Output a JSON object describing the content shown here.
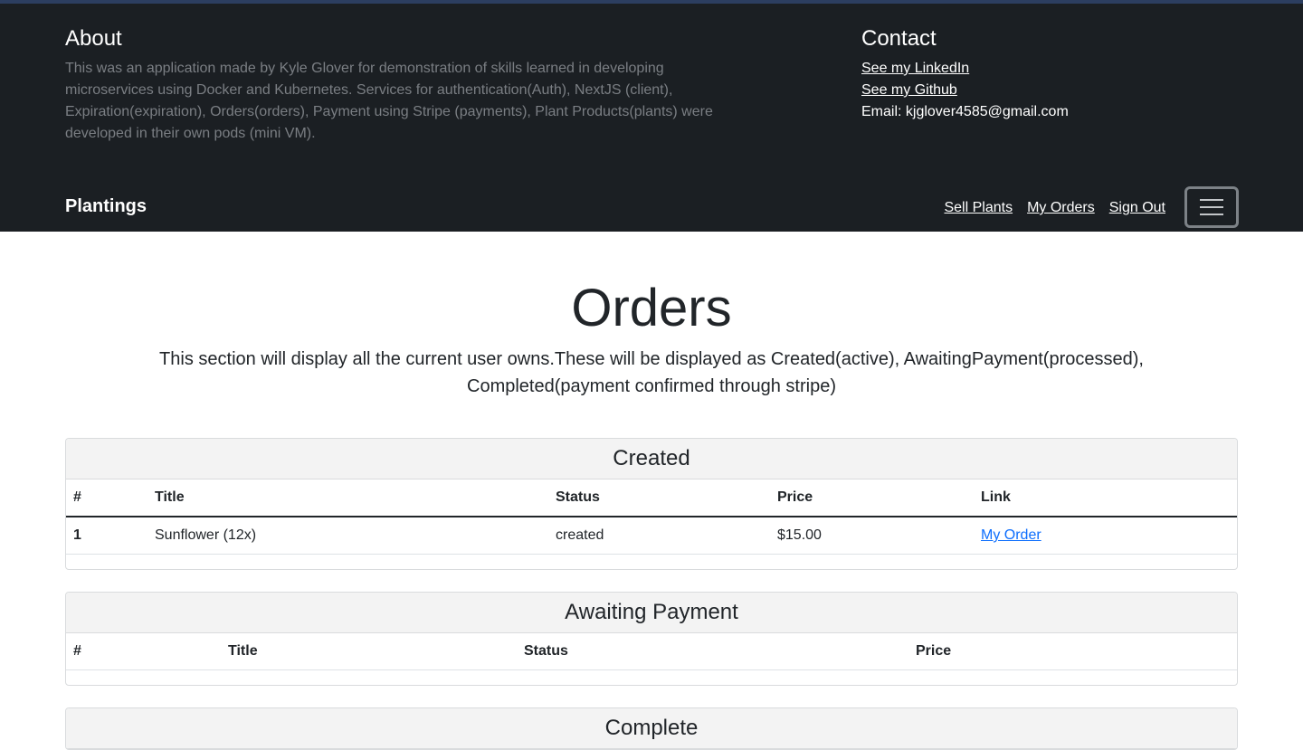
{
  "about": {
    "heading": "About",
    "text": "This was an application made by Kyle Glover for demonstration of skills learned in developing microservices using Docker and Kubernetes. Services for authentication(Auth), NextJS (client), Expiration(expiration), Orders(orders), Payment using Stripe (payments), Plant Products(plants) were developed in their own pods (mini VM)."
  },
  "contact": {
    "heading": "Contact",
    "linkedin": "See my LinkedIn",
    "github": "See my Github",
    "email": "Email: kjglover4585@gmail.com"
  },
  "navbar": {
    "brand": "Plantings",
    "links": [
      "Sell Plants",
      "My Orders",
      "Sign Out"
    ],
    "toggler_icon": "hamburger-icon"
  },
  "page": {
    "title": "Orders",
    "description": "This section will display all the current user owns.These will be displayed as Created(active), AwaitingPayment(processed), Completed(payment confirmed through stripe)"
  },
  "created": {
    "heading": "Created",
    "columns": [
      "#",
      "Title",
      "Status",
      "Price",
      "Link"
    ],
    "rows": [
      {
        "index": "1",
        "title": "Sunflower (12x)",
        "status": "created",
        "price": "$15.00",
        "link": "My Order"
      }
    ]
  },
  "awaiting": {
    "heading": "Awaiting Payment",
    "columns": [
      "#",
      "Title",
      "Status",
      "Price"
    ],
    "rows": []
  },
  "complete": {
    "heading": "Complete"
  },
  "colors": {
    "navbar_bg": "#1b1f23",
    "link_blue": "#0d6efd",
    "muted_text": "#7a7e83"
  }
}
